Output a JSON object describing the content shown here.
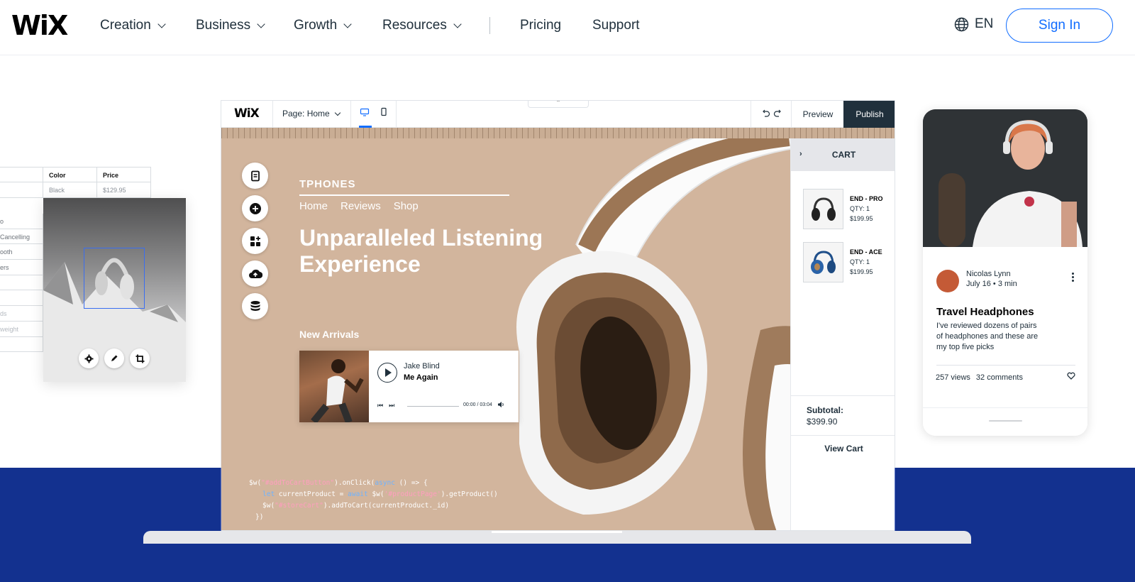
{
  "nav": {
    "logo": "WiX",
    "items": [
      {
        "label": "Creation"
      },
      {
        "label": "Business"
      },
      {
        "label": "Growth"
      },
      {
        "label": "Resources"
      }
    ],
    "pricing": "Pricing",
    "support": "Support",
    "language": "EN",
    "sign_in": "Sign In"
  },
  "left_table": {
    "headers": [
      "Color",
      "Price"
    ],
    "row": [
      "Black",
      "$129.95"
    ],
    "side_labels": [
      "o",
      "Cancelling",
      "ooth",
      "ers",
      "",
      "",
      "ds",
      "weight",
      ""
    ]
  },
  "editor": {
    "logo": "WiX",
    "page_selector": "Page: Home",
    "preview": "Preview",
    "publish": "Publish"
  },
  "site": {
    "brand": "TPHONES",
    "nav": [
      "Home",
      "Reviews",
      "Shop"
    ],
    "headline": "Unparalleled Listening Experience",
    "new_arrivals": "New Arrivals",
    "player": {
      "artist": "Jake Blind",
      "song": "Me Again",
      "time": "00:00 / 03:04"
    }
  },
  "cart": {
    "title": "CART",
    "items": [
      {
        "name": "END - PRO",
        "qty": "QTY: 1",
        "price": "$199.95"
      },
      {
        "name": "END - ACE",
        "qty": "QTY: 1",
        "price": "$199.95"
      }
    ],
    "subtotal_label": "Subtotal:",
    "subtotal_value": "$399.90",
    "view_cart": "View Cart"
  },
  "code": {
    "line1_a": "$w(",
    "line1_s": "\"#addToCartButton\"",
    "line1_b": ").onClick(",
    "line1_k": "async",
    "line1_c": " () => {",
    "line2_k1": "let",
    "line2_a": " currentProduct = ",
    "line2_k2": "await",
    "line2_b": " $w(",
    "line2_s": "'#productPage'",
    "line2_c": ").getProduct()",
    "line3_a": "$w(",
    "line3_s": "\"#storeCart\"",
    "line3_b": ").addToCart(currentProduct._id)",
    "line4": "})"
  },
  "blog": {
    "author": "Nicolas Lynn",
    "date": "July 16",
    "read_time": "3 min",
    "title": "Travel Headphones",
    "excerpt": "I've reviewed dozens of pairs of headphones and these are my top five picks",
    "views": "257 views",
    "comments": "32 comments"
  },
  "colors": {
    "accent": "#116dff",
    "band": "#13318f",
    "canvas": "#d2b59d",
    "publish_bg": "#20303c"
  }
}
